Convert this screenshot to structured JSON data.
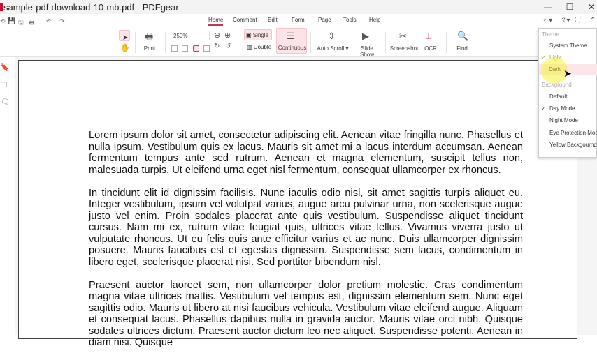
{
  "window": {
    "title": "sample-pdf-download-10-mb.pdf - PDFgear",
    "minimize": "—",
    "maximize": "☐",
    "close": "✕"
  },
  "quick_access": [
    "⟲",
    "💾",
    "🖫",
    "🖶",
    "↶",
    "↷"
  ],
  "menu": {
    "items": [
      "Home",
      "Comment",
      "Edit",
      "Form",
      "Page",
      "Tools",
      "Help"
    ],
    "active": "Home"
  },
  "toolbar": {
    "print": "Print",
    "zoom": "250%",
    "single": "Single",
    "double": "Double",
    "continuous": "Continuous",
    "auto_scroll": "Auto Scroll",
    "slide_show": "Slide Show",
    "screenshot": "Screenshot",
    "ocr": "OCR",
    "find": "Find"
  },
  "theme_menu": {
    "theme_header": "Theme",
    "system_theme": "System Theme",
    "light": "Light",
    "dark": "Dark",
    "background_header": "Background",
    "default": "Default",
    "day_mode": "Day Mode",
    "night_mode": "Night Mode",
    "eye_protection": "Eye Protection Mode",
    "yellow": "Yellow Backgournd",
    "selected_theme": "Light",
    "selected_background": "Day Mode"
  },
  "document": {
    "paragraphs": [
      "Lorem ipsum dolor sit amet, consectetur adipiscing elit. Aenean vitae fringilla nunc. Phasellus et nulla ipsum. Vestibulum quis ex lacus. Mauris sit amet mi a lacus interdum accumsan. Aenean fermentum tempus ante sed rutrum. Aenean et magna elementum, suscipit tellus non, malesuada turpis. Ut eleifend urna eget nisl fermentum, consequat ullamcorper ex rhoncus.",
      "In tincidunt elit id dignissim facilisis. Nunc iaculis odio nisl, sit amet sagittis turpis aliquet eu. Integer vestibulum, ipsum vel volutpat varius, augue arcu pulvinar urna, non scelerisque augue justo vel enim. Proin sodales placerat ante quis vestibulum. Suspendisse aliquet tincidunt cursus. Nam mi ex, rutrum vitae feugiat quis, ultrices vitae tellus. Vivamus viverra justo ut vulputate rhoncus. Ut eu felis quis ante efficitur varius et ac nunc. Duis ullamcorper dignissim posuere. Mauris faucibus est et egestas dignissim. Suspendisse sem lacus, condimentum in libero eget, scelerisque placerat nisi. Sed porttitor bibendum nisl.",
      "Praesent auctor laoreet sem, non ullamcorper dolor pretium molestie. Cras condimentum magna vitae ultrices mattis. Vestibulum vel tempus est, dignissim elementum sem. Nunc eget sagittis odio. Mauris ut libero at nisi faucibus vehicula. Vestibulum vitae eleifend augue. Aliquam et consequat lacus. Phasellus dapibus nulla in gravida auctor. Mauris vitae orci nibh. Quisque sodales ultrices dictum. Praesent auctor dictum leo nec aliquet. Suspendisse potenti. Aenean in diam nisi. Quisque"
    ]
  },
  "colors": {
    "accent": "#c8354e",
    "highlight": "#fbe3e7"
  }
}
